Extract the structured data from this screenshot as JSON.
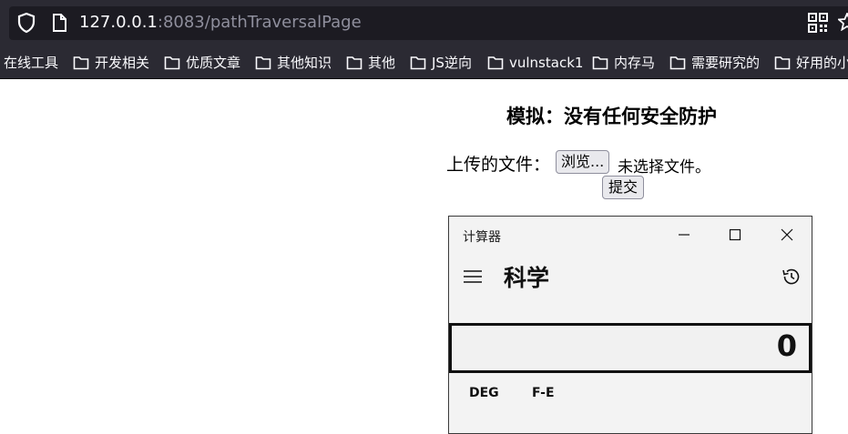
{
  "browser": {
    "url_host": "127.0.0.1",
    "url_rest": ":8083/pathTraversalPage",
    "bookmarks": [
      {
        "label": "在线工具",
        "folder": false
      },
      {
        "label": "开发相关",
        "folder": true
      },
      {
        "label": "优质文章",
        "folder": true
      },
      {
        "label": "其他知识",
        "folder": true
      },
      {
        "label": "其他",
        "folder": true
      },
      {
        "label": "JS逆向",
        "folder": true
      },
      {
        "label": "vulnstack1",
        "folder": true
      },
      {
        "label": "内存马",
        "folder": true
      },
      {
        "label": "需要研究的",
        "folder": true
      },
      {
        "label": "好用的小",
        "folder": true
      }
    ]
  },
  "page": {
    "title": "模拟：没有任何安全防护",
    "upload_label": "上传的文件：",
    "browse_button": "浏览...",
    "no_file_text": "未选择文件。",
    "submit_button": "提交"
  },
  "calculator": {
    "window_title": "计算器",
    "mode": "科学",
    "display_value": "0",
    "angle_mode": "DEG",
    "fe_label": "F-E"
  },
  "colors": {
    "chrome_bg": "#2b2a33",
    "urlbar_bg": "#1c1b22",
    "calc_bg": "#f3f3f3"
  }
}
